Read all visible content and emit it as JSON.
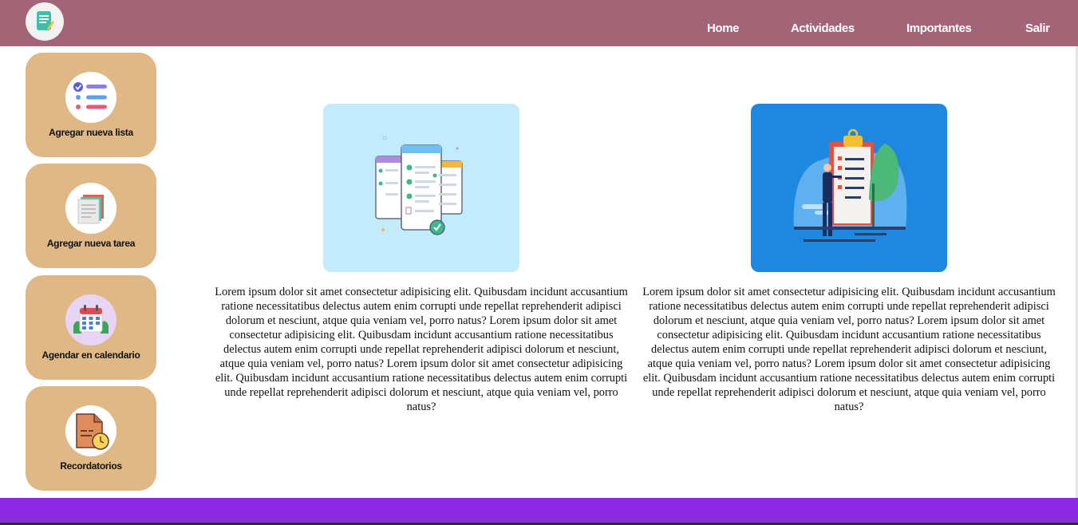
{
  "nav": {
    "items": [
      {
        "label": "Home"
      },
      {
        "label": "Actividades"
      },
      {
        "label": "Importantes"
      },
      {
        "label": "Salir"
      }
    ]
  },
  "sidebar": {
    "items": [
      {
        "label": "Agregar nueva lista",
        "icon": "checklist-icon"
      },
      {
        "label": "Agregar nueva tarea",
        "icon": "notes-icon"
      },
      {
        "label": "Agendar en calendario",
        "icon": "calendar-icon"
      },
      {
        "label": "Recordatorios",
        "icon": "document-clock-icon"
      }
    ]
  },
  "main": {
    "columns": [
      {
        "image": "task-lists-illustration",
        "paragraph": "Lorem ipsum dolor sit amet consectetur adipisicing elit. Quibusdam incidunt accusantium ratione necessitatibus delectus autem enim corrupti unde repellat reprehenderit adipisci dolorum et nesciunt, atque quia veniam vel, porro natus? Lorem ipsum dolor sit amet consectetur adipisicing elit. Quibusdam incidunt accusantium ratione necessitatibus delectus autem enim corrupti unde repellat reprehenderit adipisci dolorum et nesciunt, atque quia veniam vel, porro natus? Lorem ipsum dolor sit amet consectetur adipisicing elit. Quibusdam incidunt accusantium ratione necessitatibus delectus autem enim corrupti unde repellat reprehenderit adipisci dolorum et nesciunt, atque quia veniam vel, porro natus?"
      },
      {
        "image": "clipboard-person-illustration",
        "paragraph": "Lorem ipsum dolor sit amet consectetur adipisicing elit. Quibusdam incidunt accusantium ratione necessitatibus delectus autem enim corrupti unde repellat reprehenderit adipisci dolorum et nesciunt, atque quia veniam vel, porro natus? Lorem ipsum dolor sit amet consectetur adipisicing elit. Quibusdam incidunt accusantium ratione necessitatibus delectus autem enim corrupti unde repellat reprehenderit adipisci dolorum et nesciunt, atque quia veniam vel, porro natus? Lorem ipsum dolor sit amet consectetur adipisicing elit. Quibusdam incidunt accusantium ratione necessitatibus delectus autem enim corrupti unde repellat reprehenderit adipisci dolorum et nesciunt, atque quia veniam vel, porro natus?"
      }
    ]
  },
  "colors": {
    "header": "#a36478",
    "sidebar_card": "#dfb885",
    "footer": "#8a2be2"
  }
}
